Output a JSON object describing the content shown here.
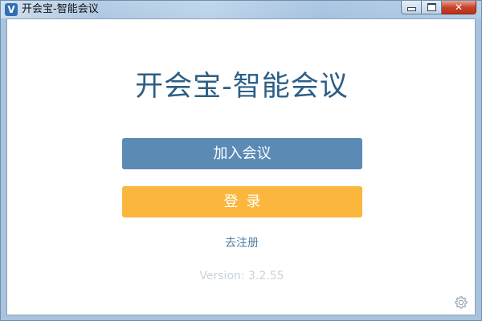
{
  "window": {
    "title": "开会宝-智能会议",
    "app_icon_glyph": "V",
    "controls": {
      "minimize_icon": "minimize-icon",
      "maximize_icon": "maximize-icon",
      "close_glyph": "✕"
    }
  },
  "main": {
    "title": "开会宝-智能会议",
    "join_button_label": "加入会议",
    "login_button_label": "登录",
    "register_link_label": "去注册",
    "version_text": "Version: 3.2.55"
  },
  "settings": {
    "icon": "gear-icon"
  },
  "colors": {
    "title": "#2b5f86",
    "join_button": "#5b8bb5",
    "login_button": "#fbb63d",
    "link": "#4f7ea6",
    "version": "#c9d2da"
  }
}
